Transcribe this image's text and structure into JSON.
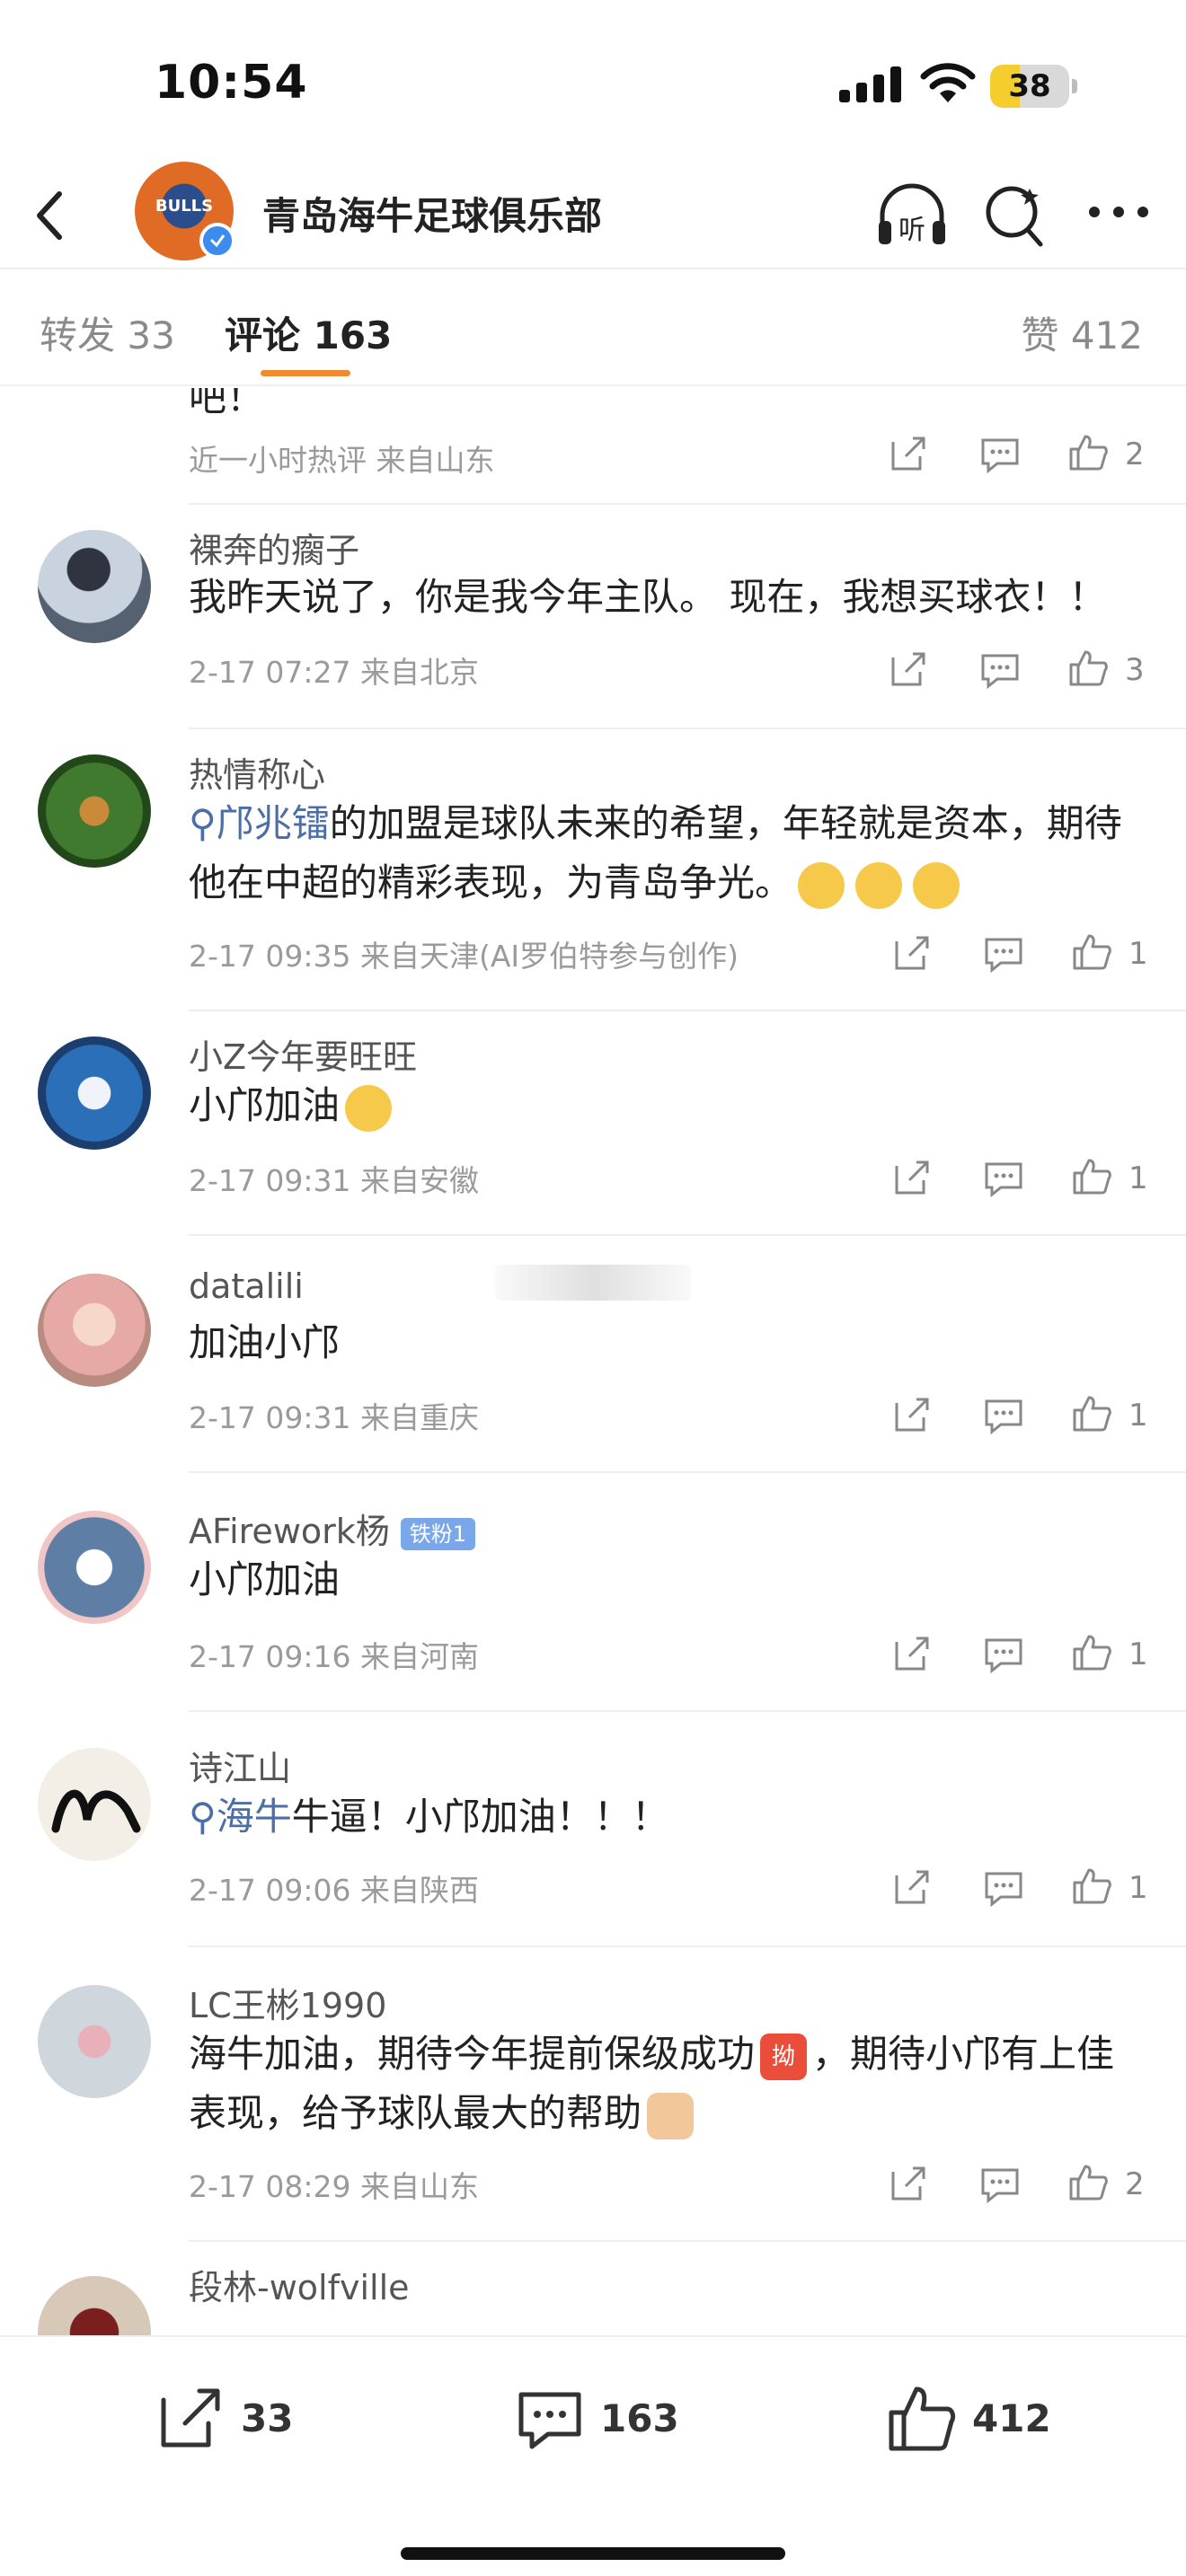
{
  "status_bar": {
    "time": "10:54",
    "battery": "38",
    "battery_level": 0.38
  },
  "header": {
    "title": "青岛海牛足球俱乐部",
    "avatar_logo": "BULLS",
    "back_icon": "chevron-left-icon",
    "listen_label": "听",
    "search_icon": "search-icon",
    "more_icon": "more-icon"
  },
  "tabs": {
    "repost": "转发 33",
    "comment": "评论 163",
    "like": "赞 412",
    "active": "comment"
  },
  "comments": [
    {
      "name": "",
      "text": "吧！",
      "meta": "近一小时热评  来自山东",
      "likes": "2"
    },
    {
      "name": "裸奔的瘸子",
      "text": "我昨天说了，你是我今年主队。 现在，我想买球衣！！",
      "meta": "2-17 07:27  来自北京",
      "likes": "3"
    },
    {
      "name": "热情称心",
      "mention": "邝兆镭",
      "text": "的加盟是球队未来的希望，年轻就是资本，期待他在中超的精彩表现，为青岛争光。",
      "meta": "2-17 09:35  来自天津(AI罗伯特参与创作)",
      "likes": "1"
    },
    {
      "name": "小Z今年要旺旺",
      "text": "小邝加油",
      "meta": "2-17 09:31  来自安徽",
      "likes": "1"
    },
    {
      "name": "datalili",
      "text": "加油小邝",
      "meta": "2-17 09:31  来自重庆",
      "likes": "1"
    },
    {
      "name": "AFirework杨",
      "badge": "铁粉1",
      "text": "小邝加油",
      "meta": "2-17 09:16  来自河南",
      "likes": "1"
    },
    {
      "name": "诗江山",
      "mention": "海牛",
      "text": "牛逼！小邝加油！！！",
      "meta": "2-17 09:06  来自陕西",
      "likes": "1"
    },
    {
      "name": "LC王彬1990",
      "text": "海牛加油，期待今年提前保级成功",
      "text2": "，期待小邝有上佳表现，给予球队最大的帮助",
      "emoji_label": "拗",
      "meta": "2-17 08:29  来自山东",
      "likes": "2"
    },
    {
      "name": "段林-wolfville",
      "text": "",
      "meta": "",
      "likes": ""
    }
  ],
  "bottom_bar": {
    "repost_count": "33",
    "comment_count": "163",
    "like_count": "412"
  },
  "colors": {
    "accent": "#f08a2c",
    "mention": "#4c6ea8",
    "badge": "#7aa7ea",
    "battery": "#f5cd2e"
  }
}
